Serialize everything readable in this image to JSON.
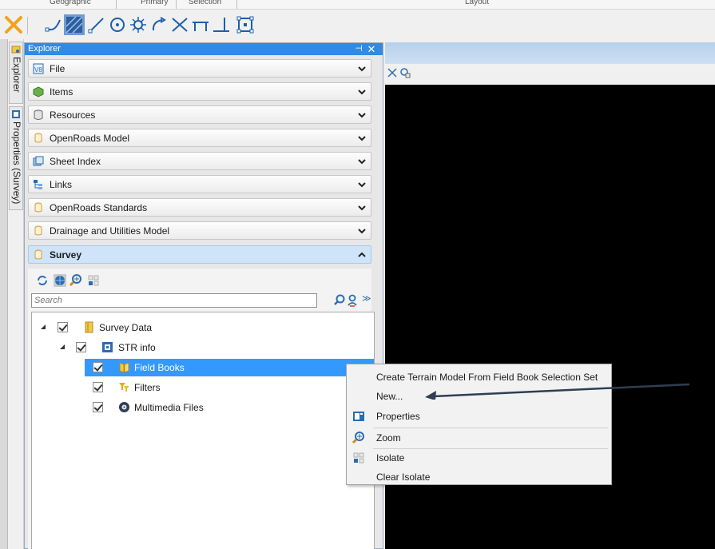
{
  "ribbon": {
    "groups": [
      "Geographic",
      "Primary",
      "Selection",
      "Layout"
    ]
  },
  "toolbar": {
    "icons": [
      "cancel-x-icon",
      "line-curve-icon",
      "hatch-icon",
      "diagonal-line-icon",
      "circle-target-icon",
      "sun-target-icon",
      "arc-arrow-icon",
      "cross-icon",
      "bracket-icon",
      "corner-icon",
      "bounding-box-icon"
    ]
  },
  "side_tabs": [
    {
      "label": "Explorer",
      "icon": "explorer-icon"
    },
    {
      "label": "Properties (Survey)",
      "icon": "properties-icon"
    }
  ],
  "explorer": {
    "title": "Explorer",
    "pin": "⊣",
    "close": "✕",
    "sections": [
      {
        "label": "File",
        "icon": "file-icon"
      },
      {
        "label": "Items",
        "icon": "items-icon"
      },
      {
        "label": "Resources",
        "icon": "resources-icon"
      },
      {
        "label": "OpenRoads Model",
        "icon": "cylinder-icon"
      },
      {
        "label": "Sheet Index",
        "icon": "sheet-index-icon"
      },
      {
        "label": "Links",
        "icon": "links-icon"
      },
      {
        "label": "OpenRoads Standards",
        "icon": "cylinder-icon"
      },
      {
        "label": "Drainage and Utilities Model",
        "icon": "cylinder-icon"
      },
      {
        "label": "Survey",
        "icon": "cylinder-icon",
        "expanded": true
      }
    ]
  },
  "survey": {
    "tool_icons": [
      "refresh-icon",
      "globe-icon",
      "zoom-icon",
      "isolate-icon"
    ],
    "search": {
      "placeholder": "Search",
      "value": ""
    },
    "more": "≫",
    "tree": [
      {
        "label": "Survey Data",
        "icon": "survey-data-icon",
        "level": 0,
        "checked": true,
        "expanded": true
      },
      {
        "label": "STR info",
        "icon": "str-info-icon",
        "level": 1,
        "checked": true,
        "expanded": true
      },
      {
        "label": "Field Books",
        "icon": "field-books-icon",
        "level": 2,
        "checked": true,
        "selected": true
      },
      {
        "label": "Filters",
        "icon": "filters-icon",
        "level": 2,
        "checked": true
      },
      {
        "label": "Multimedia Files",
        "icon": "multimedia-icon",
        "level": 2,
        "checked": true
      }
    ]
  },
  "context_menu": {
    "items": [
      {
        "label": "Create Terrain Model From Field Book Selection Set",
        "icon": ""
      },
      {
        "label": "New...",
        "icon": ""
      },
      {
        "label": "Properties",
        "icon": "properties-icon"
      },
      {
        "label": "Zoom",
        "icon": "zoom-icon"
      },
      {
        "label": "Isolate",
        "icon": "isolate-icon"
      },
      {
        "label": "Clear Isolate",
        "icon": ""
      }
    ]
  },
  "colors": {
    "title_blue": "#2e8be6",
    "selection_blue": "#3399ff",
    "view_background": "#000000",
    "arrow": "#2f3e52"
  }
}
